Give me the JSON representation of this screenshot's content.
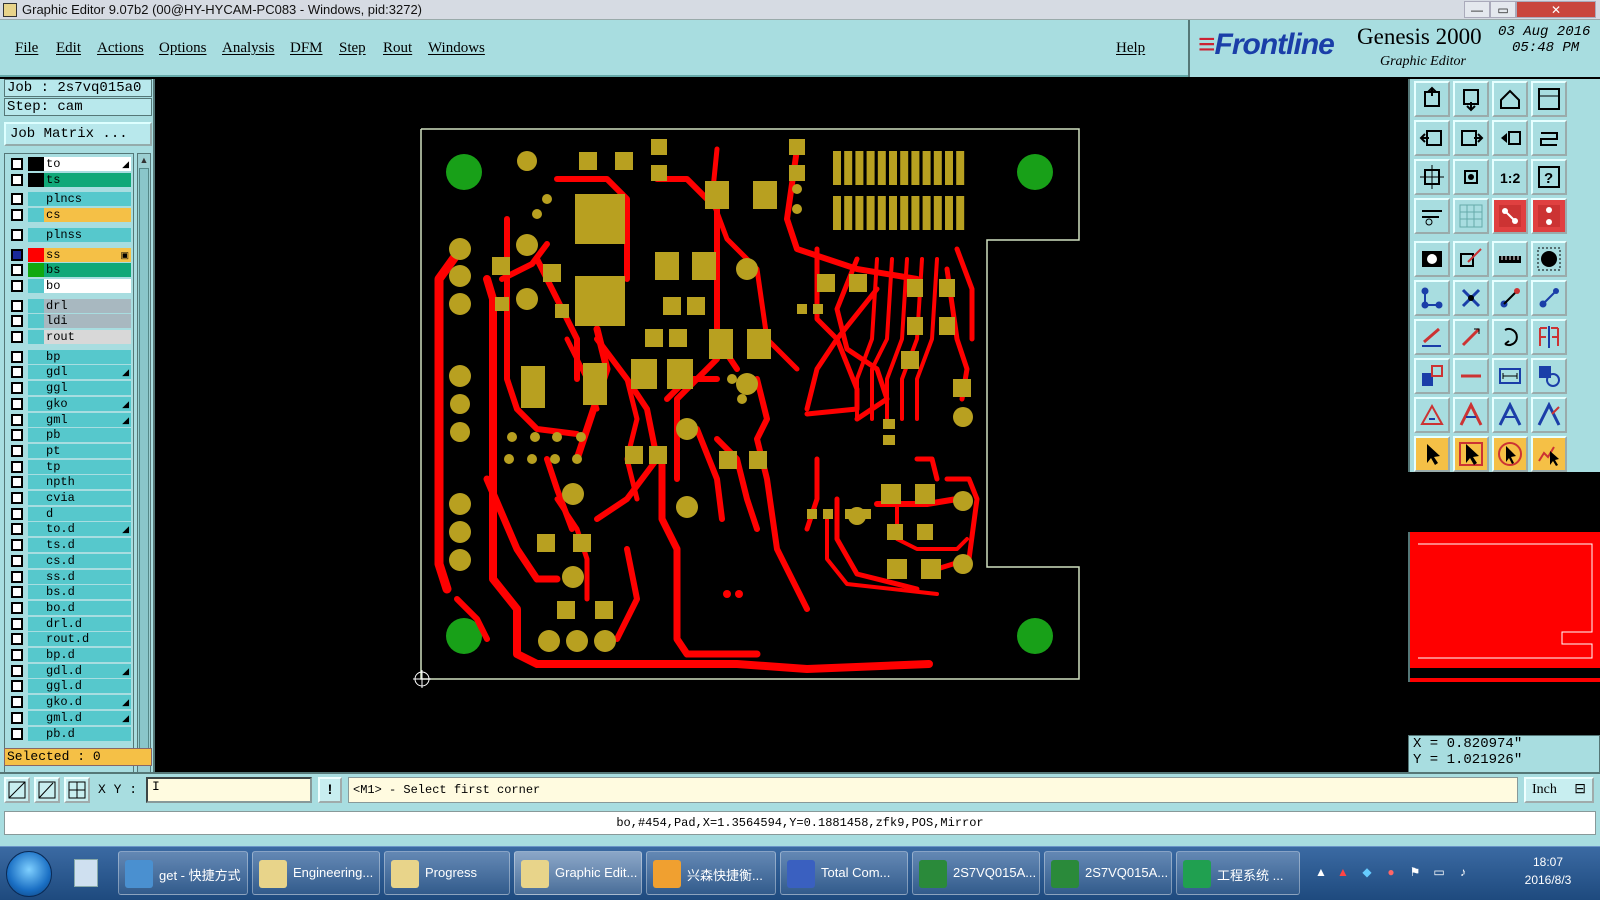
{
  "window": {
    "title": "Graphic Editor 9.07b2 (00@HY-HYCAM-PC083 - Windows, pid:3272)",
    "controls": [
      "—",
      "▭",
      "✕"
    ]
  },
  "menu": {
    "items": [
      "File",
      "Edit",
      "Actions",
      "Options",
      "Analysis",
      "DFM",
      "Step",
      "Rout",
      "Windows"
    ],
    "help": "Help"
  },
  "brand": {
    "logo": "Frontline",
    "product": "Genesis 2000",
    "subtitle": "Graphic Editor",
    "date": "03 Aug 2016",
    "time": "05:48 PM"
  },
  "job": {
    "job_label": "Job : 2s7vq015a0",
    "step_label": "Step: cam",
    "matrix_button": "Job Matrix ..."
  },
  "layers": [
    {
      "name": "to",
      "color": "#ffffff",
      "swatch": "#000000",
      "mark": "◢"
    },
    {
      "name": "ts",
      "color": "#10a878",
      "swatch": "#000000",
      "mark": ""
    },
    {
      "name": "plncs",
      "color": "#56c8cc",
      "swatch": "#56c8cc",
      "mark": ""
    },
    {
      "name": "cs",
      "color": "#f5c046",
      "swatch": "#56c8cc",
      "mark": ""
    },
    {
      "name": "plnss",
      "color": "#56c8cc",
      "swatch": "#56c8cc",
      "mark": ""
    },
    {
      "name": "ss",
      "color": "#f5c046",
      "swatch": "#ff0000",
      "mark": "▣",
      "active": true
    },
    {
      "name": "bs",
      "color": "#10a878",
      "swatch": "#10a810",
      "mark": ""
    },
    {
      "name": "bo",
      "color": "#ffffff",
      "swatch": "#56c8cc",
      "mark": ""
    },
    {
      "name": "drl",
      "color": "#a8b8c0",
      "swatch": "#56c8cc",
      "mark": ""
    },
    {
      "name": "ldi",
      "color": "#a8b8c0",
      "swatch": "#56c8cc",
      "mark": ""
    },
    {
      "name": "rout",
      "color": "#d8d8d8",
      "swatch": "#56c8cc",
      "mark": ""
    },
    {
      "name": "bp",
      "color": "#56c8cc",
      "swatch": "#56c8cc",
      "mark": ""
    },
    {
      "name": "gdl",
      "color": "#56c8cc",
      "swatch": "#56c8cc",
      "mark": "◢"
    },
    {
      "name": "ggl",
      "color": "#56c8cc",
      "swatch": "#56c8cc",
      "mark": ""
    },
    {
      "name": "gko",
      "color": "#56c8cc",
      "swatch": "#56c8cc",
      "mark": "◢"
    },
    {
      "name": "gml",
      "color": "#56c8cc",
      "swatch": "#56c8cc",
      "mark": "◢"
    },
    {
      "name": "pb",
      "color": "#56c8cc",
      "swatch": "#56c8cc",
      "mark": ""
    },
    {
      "name": "pt",
      "color": "#56c8cc",
      "swatch": "#56c8cc",
      "mark": ""
    },
    {
      "name": "tp",
      "color": "#56c8cc",
      "swatch": "#56c8cc",
      "mark": ""
    },
    {
      "name": "npth",
      "color": "#56c8cc",
      "swatch": "#56c8cc",
      "mark": ""
    },
    {
      "name": "cvia",
      "color": "#56c8cc",
      "swatch": "#56c8cc",
      "mark": ""
    },
    {
      "name": "d",
      "color": "#56c8cc",
      "swatch": "#56c8cc",
      "mark": ""
    },
    {
      "name": "to.d",
      "color": "#56c8cc",
      "swatch": "#56c8cc",
      "mark": "◢"
    },
    {
      "name": "ts.d",
      "color": "#56c8cc",
      "swatch": "#56c8cc",
      "mark": ""
    },
    {
      "name": "cs.d",
      "color": "#56c8cc",
      "swatch": "#56c8cc",
      "mark": ""
    },
    {
      "name": "ss.d",
      "color": "#56c8cc",
      "swatch": "#56c8cc",
      "mark": ""
    },
    {
      "name": "bs.d",
      "color": "#56c8cc",
      "swatch": "#56c8cc",
      "mark": ""
    },
    {
      "name": "bo.d",
      "color": "#56c8cc",
      "swatch": "#56c8cc",
      "mark": ""
    },
    {
      "name": "drl.d",
      "color": "#56c8cc",
      "swatch": "#56c8cc",
      "mark": ""
    },
    {
      "name": "rout.d",
      "color": "#56c8cc",
      "swatch": "#56c8cc",
      "mark": ""
    },
    {
      "name": "bp.d",
      "color": "#56c8cc",
      "swatch": "#56c8cc",
      "mark": ""
    },
    {
      "name": "gdl.d",
      "color": "#56c8cc",
      "swatch": "#56c8cc",
      "mark": "◢"
    },
    {
      "name": "ggl.d",
      "color": "#56c8cc",
      "swatch": "#56c8cc",
      "mark": ""
    },
    {
      "name": "gko.d",
      "color": "#56c8cc",
      "swatch": "#56c8cc",
      "mark": "◢"
    },
    {
      "name": "gml.d",
      "color": "#56c8cc",
      "swatch": "#56c8cc",
      "mark": "◢"
    },
    {
      "name": "pb.d",
      "color": "#56c8cc",
      "swatch": "#56c8cc",
      "mark": ""
    }
  ],
  "selected_label": "Selected : 0",
  "toolbar_icons": [
    "zoom-home-icon",
    "zoom-in-icon",
    "zoom-home-house-icon",
    "window-icon",
    "pan-left-icon",
    "pan-right-icon",
    "undo-zoom-icon",
    "redraw-icon",
    "fit-profile-icon",
    "fit-all-icon",
    "ratio-1-2-icon",
    "help-icon",
    "measure-icon",
    "grid-icon",
    "snap-pad-icon",
    "snap-grid-icon",
    "add-pad-icon",
    "add-line-icon",
    "ruler-icon",
    "add-round-icon",
    "connect-icon",
    "cross-icon",
    "move-endpoint-icon",
    "edit-line-icon",
    "add-arc-icon",
    "slash-line-icon",
    "rotate-icon",
    "mirror-text-icon",
    "copy-shape-icon",
    "minus-line-icon",
    "dimension-icon",
    "transform-icon",
    "triangle-warning-icon",
    "text-a-icon",
    "text-a-blue-icon",
    "text-a-outline-icon",
    "select-pointer-icon",
    "select-pointer-box-icon",
    "select-pointer-circle-icon",
    "select-route-icon"
  ],
  "coordinates": {
    "x": "X = 0.820974\"",
    "y": "Y = 1.021926\""
  },
  "command": {
    "xy_label": "X Y :",
    "input_value": "I",
    "help": "!",
    "prompt": "<M1> - Select first corner",
    "unit": "Inch"
  },
  "status_text": "bo,#454,Pad,X=1.3564594,Y=0.1881458,zfk9,POS,Mirror",
  "taskbar": {
    "items": [
      {
        "label": "get - 快捷方式",
        "color": "#4a90d0"
      },
      {
        "label": "Engineering...",
        "color": "#e8d48a"
      },
      {
        "label": "Progress",
        "color": "#e8d48a"
      },
      {
        "label": "Graphic Edit...",
        "color": "#e8d48a",
        "active": true
      },
      {
        "label": "兴森快捷衡...",
        "color": "#f0a030"
      },
      {
        "label": "Total Com...",
        "color": "#3a60c0"
      },
      {
        "label": "2S7VQ015A...",
        "color": "#2a8a3a"
      },
      {
        "label": "2S7VQ015A...",
        "color": "#2a8a3a"
      },
      {
        "label": "工程系统 ...",
        "color": "#20a050"
      }
    ],
    "time": "18:07",
    "date": "2016/8/3"
  },
  "colors": {
    "panel": "#a8dde0",
    "trace": "#ff0000",
    "pad": "#b8a020",
    "mount_hole": "#18a018",
    "outline": "#cfe0c0"
  }
}
